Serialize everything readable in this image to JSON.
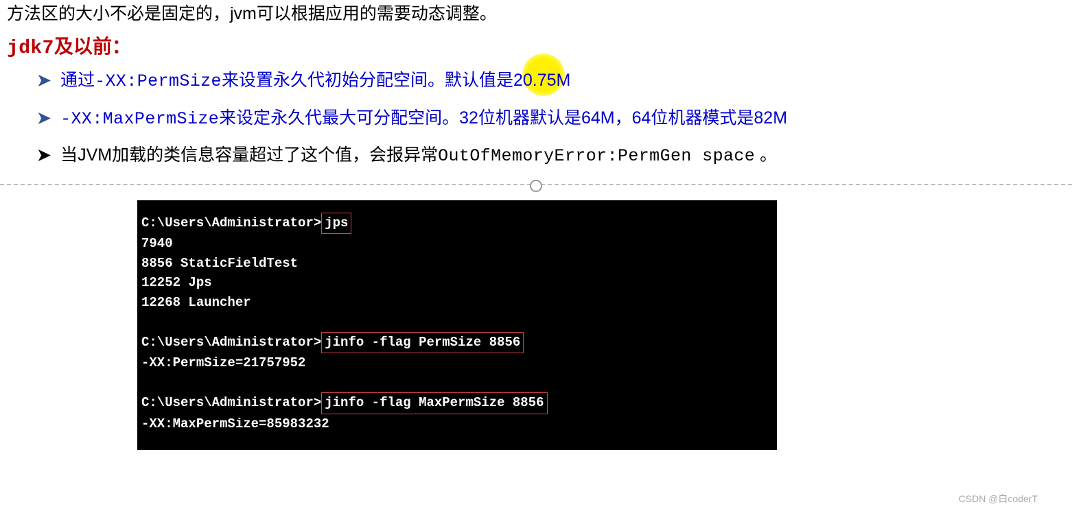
{
  "intro": "方法区的大小不必是固定的，jvm可以根据应用的需要动态调整。",
  "title": {
    "mono": "jdk7",
    "cn": "及以前："
  },
  "list": {
    "item1": {
      "prefix": "通过",
      "flag": "-XX:PermSize",
      "mid": "来设置永久代初始分配空间。默认值是",
      "val_part1": "20.",
      "val_part2": "75M"
    },
    "item2": {
      "flag": "-XX:MaxPermSize",
      "mid": "来设定永久代最大可分配空间。32位机器默认是64M，64位机器模式是82M"
    },
    "item3": {
      "prefix": "当JVM加载的类信息容量超过了这个值，会报异常",
      "err": "OutOfMemoryError:PermGen space",
      "suffix": " 。"
    }
  },
  "terminal": {
    "l1_prompt": "C:\\Users\\Administrator>",
    "l1_cmd": "jps",
    "l2": "7940",
    "l3": "8856 StaticFieldTest",
    "l4": "12252 Jps",
    "l5": "12268 Launcher",
    "l6_prompt": "C:\\Users\\Administrator>",
    "l6_cmd": "jinfo -flag PermSize 8856",
    "l7": "-XX:PermSize=21757952",
    "l8_prompt": "C:\\Users\\Administrator>",
    "l8_cmd": "jinfo -flag MaxPermSize 8856",
    "l9": "-XX:MaxPermSize=85983232"
  },
  "watermark": "CSDN @白coderT"
}
